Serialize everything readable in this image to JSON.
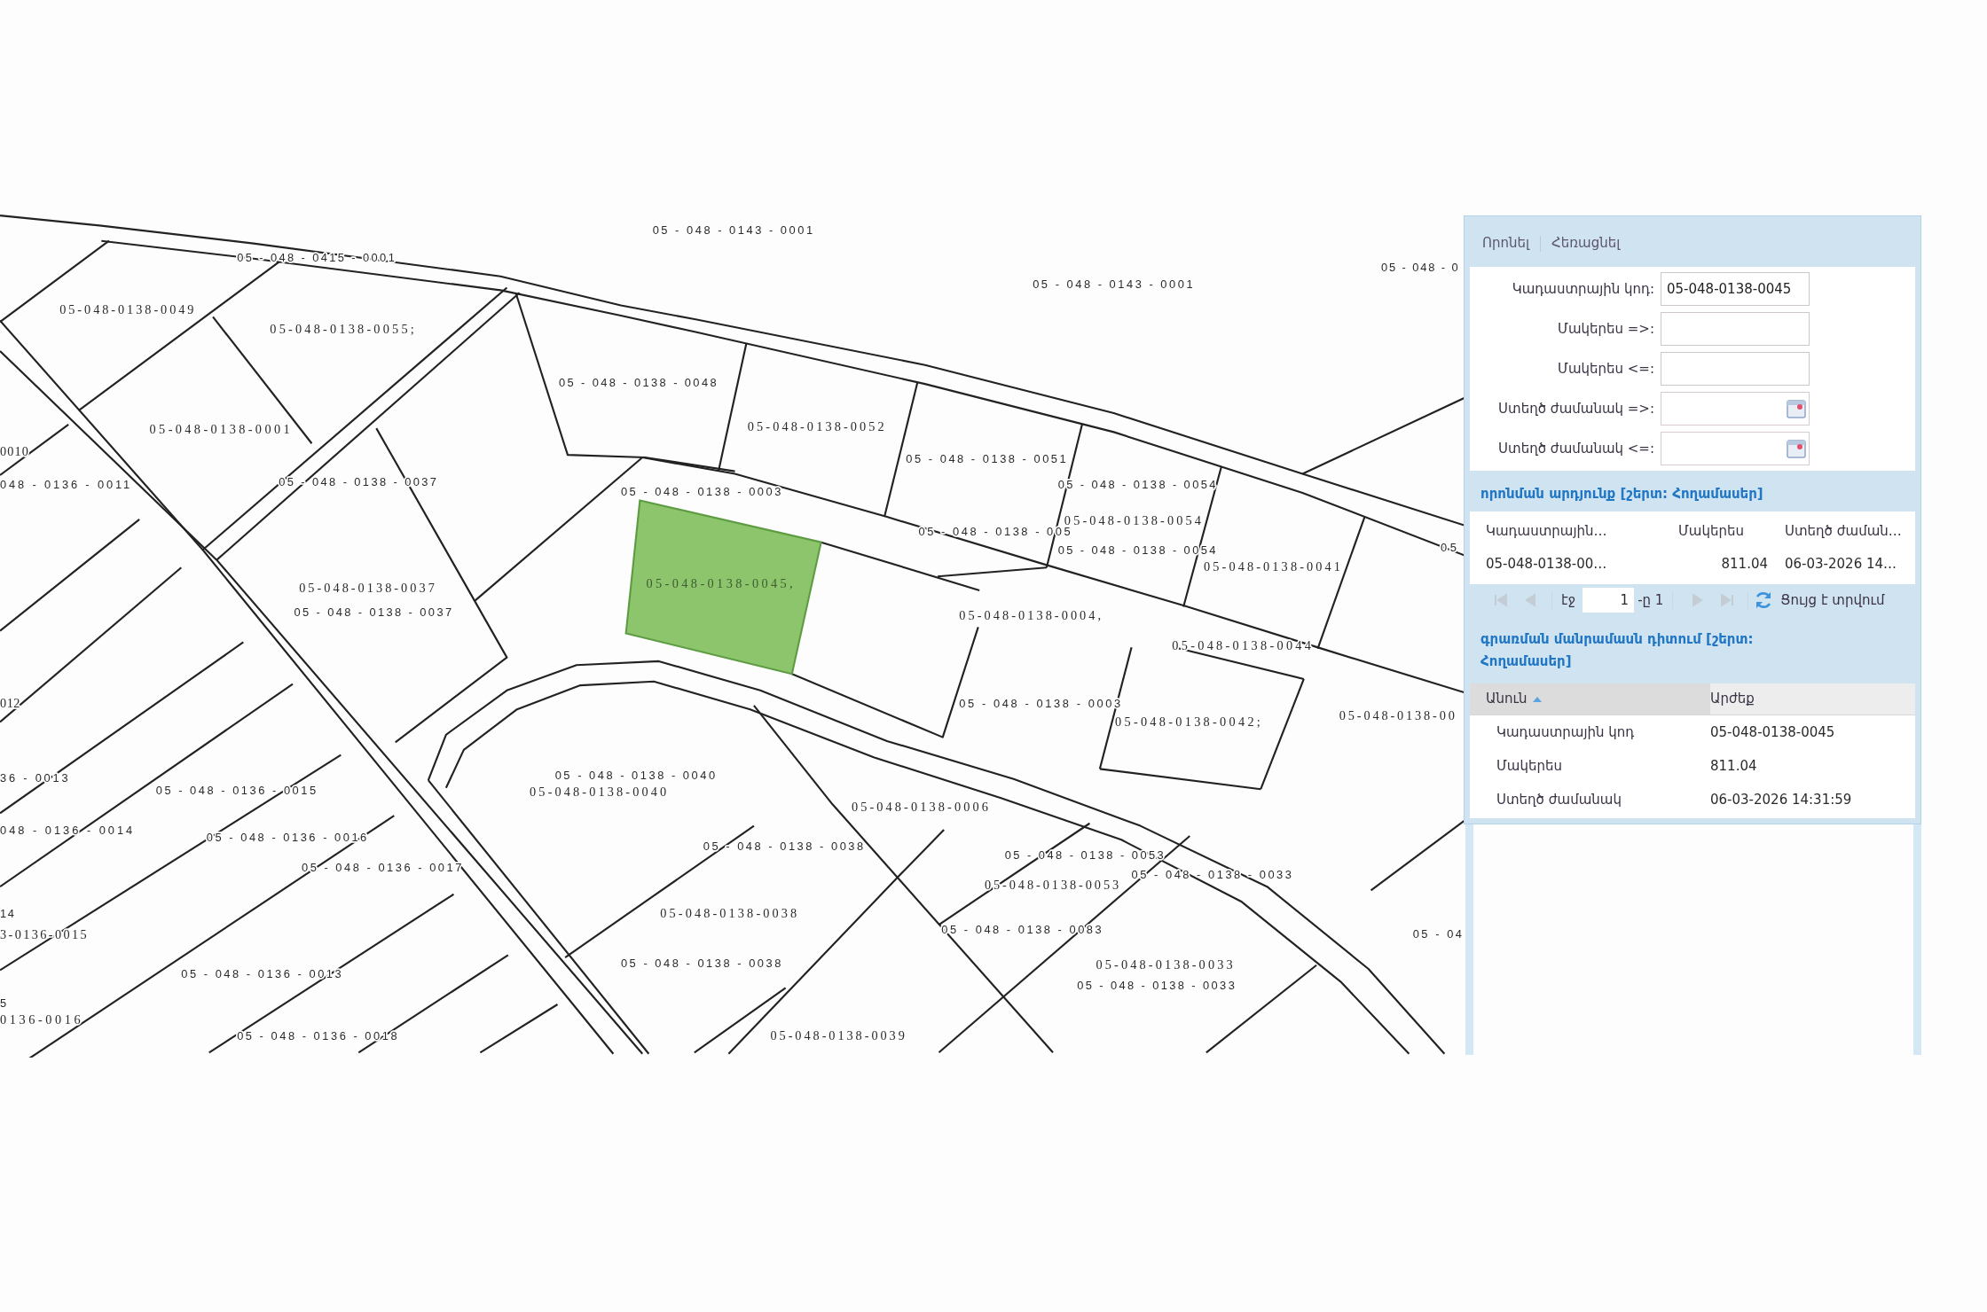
{
  "map": {
    "parcel_labels": [
      "05 - 048 - 0143 - 0001",
      "05 - 048 - 0415 - 0001",
      "05 - 048 - 0",
      "05 - 048 - 0143 - 0001",
      "05-048-0138-0049",
      "05-048-0138-0055;",
      "05 - 048 - 0138 - 0048",
      "05-048-0138-0001",
      "05-048-0138-0052",
      "0010",
      "05 - 048 - 0138 - 0051",
      "048 - 0136 - 0011",
      "05 - 048 - 0138 - 0037",
      "05 - 048 - 0138 - 0003",
      "05 - 048 - 0138 - 0054",
      "05 - 048 - 0138 - 005",
      "05-048-0138-0054",
      "05 - 048 - 0138 - 0054",
      "05",
      "05-048-0138-0041",
      "05-048-0138-0037",
      "05 - 048 - 0138 - 0037",
      "05-048-0138-0004,",
      "05-048-0138-0044",
      "012",
      "05 - 048 - 0138 - 0003",
      "05-048-0138-0042;",
      "05-048-0138-00",
      "36 - 0013",
      "05 - 048 - 0138 - 0040",
      "05 - 048 - 0136 - 0015",
      "05-048-0138-0040",
      "05-048-0138-0006",
      "048 - 0136 - 0014",
      "05 - 048 - 0136 - 0016",
      "05 - 048 - 0138 - 0038",
      "05 - 048 - 0138 - 0053",
      "05 - 048 - 0136 - 0017",
      "05 - 048 - 0138 - 0033",
      "05-048-0138-0053",
      "14",
      "05-048-0138-0038",
      "3-0136-0015",
      "05 - 048 - 0138 - 0083",
      "05 - 04",
      "05 - 048 - 0138 - 0038",
      "05-048-0138-0033",
      "05 - 048 - 0136 - 0013",
      "05 - 048 - 0138 - 0033",
      "5",
      "0136-0016",
      "05 - 048 - 0136 - 0018",
      "05-048-0138-0039"
    ],
    "selected_parcel": {
      "label": "05-048-0138-0045,"
    }
  },
  "search_panel": {
    "toolbar": [
      "Որոնել",
      "Հեռացնել"
    ],
    "fields": [
      {
        "kind": "text",
        "label": "Կադաստրային կոդ:",
        "value": "05-048-0138-0045"
      },
      {
        "kind": "text",
        "label": "Մակերես =>:"
      },
      {
        "kind": "text",
        "label": "Մակերես <=:"
      },
      {
        "kind": "date",
        "label": "Ստեղծ ժամանակ =>:"
      },
      {
        "kind": "date",
        "label": "Ստեղծ ժամանակ <=:"
      }
    ]
  },
  "results": {
    "title": "որոնման արդյունք [շերտ: Հողամասեր]",
    "columns": [
      "Կադաստրային…",
      "Մակերես",
      "Ստեղծ ժաման…"
    ],
    "rows": [
      [
        "05-048-0138-00…",
        "811.04",
        "06-03-2026 14…"
      ]
    ],
    "pager": {
      "nav": [
        {
          "kind": "first",
          "disabled": true
        },
        {
          "kind": "prev",
          "disabled": true
        },
        {
          "kind": "next",
          "disabled": true
        },
        {
          "kind": "last",
          "disabled": true
        }
      ],
      "page_label": "էջ",
      "page": "1",
      "page_count": "-ը 1",
      "status": "Ցույց է տրվում"
    }
  },
  "details": {
    "title": "գրառման մանրամասն դիտում [շերտ: Հողամասեր]",
    "columns": [
      {
        "label": "Անուն",
        "sorted": true
      },
      {
        "label": "Արժեք",
        "sorted": false
      }
    ],
    "rows": [
      {
        "name": "Կադաստրային կոդ",
        "value": "05-048-0138-0045"
      },
      {
        "name": "Մակերես",
        "value": "811.04"
      },
      {
        "name": "Ստեղծ ժամանակ",
        "value": "06-03-2026 14:31:59"
      }
    ]
  }
}
